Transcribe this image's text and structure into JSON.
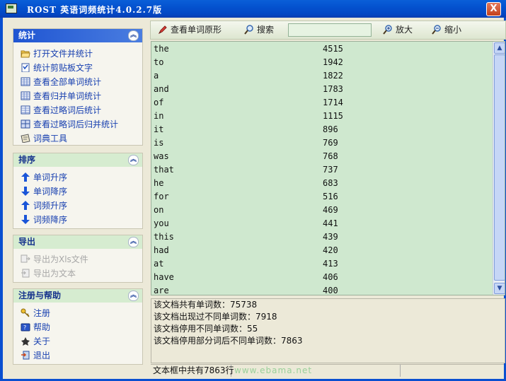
{
  "window": {
    "title": "ROST 英语词频统计4.0.2.7版",
    "close_label": "X"
  },
  "groups": [
    {
      "title": "统计",
      "items": [
        {
          "label": "打开文件并统计",
          "icon": "open-folder-icon"
        },
        {
          "label": "统计剪贴板文字",
          "icon": "clipboard-icon"
        },
        {
          "label": "查看全部单词统计",
          "icon": "table-icon"
        },
        {
          "label": "查看归并单词统计",
          "icon": "table-icon"
        },
        {
          "label": "查看过略词后统计",
          "icon": "table-icon"
        },
        {
          "label": "查看过略词后归并统计",
          "icon": "table-icon"
        },
        {
          "label": "词典工具",
          "icon": "dictionary-icon"
        }
      ]
    },
    {
      "title": "排序",
      "items": [
        {
          "label": "单词升序",
          "icon": "arrow-up-icon"
        },
        {
          "label": "单词降序",
          "icon": "arrow-down-icon"
        },
        {
          "label": "词频升序",
          "icon": "arrow-up-icon"
        },
        {
          "label": "词频降序",
          "icon": "arrow-down-icon"
        }
      ]
    },
    {
      "title": "导出",
      "items": [
        {
          "label": "导出为Xls文件",
          "icon": "export-xls-icon"
        },
        {
          "label": "导出为文本",
          "icon": "export-text-icon"
        }
      ]
    },
    {
      "title": "注册与帮助",
      "items": [
        {
          "label": "注册",
          "icon": "key-icon"
        },
        {
          "label": "帮助",
          "icon": "help-book-icon"
        },
        {
          "label": "关于",
          "icon": "about-icon"
        },
        {
          "label": "退出",
          "icon": "exit-door-icon"
        }
      ]
    }
  ],
  "toolbar": {
    "view_original": "查看单词原形",
    "search": "搜索",
    "search_value": "",
    "zoom_in": "放大",
    "zoom_out": "缩小"
  },
  "words": [
    {
      "w": "the",
      "c": "4515"
    },
    {
      "w": "to",
      "c": "1942"
    },
    {
      "w": "a",
      "c": "1822"
    },
    {
      "w": "and",
      "c": "1783"
    },
    {
      "w": "of",
      "c": "1714"
    },
    {
      "w": "in",
      "c": "1115"
    },
    {
      "w": "it",
      "c": "896"
    },
    {
      "w": "is",
      "c": "769"
    },
    {
      "w": "was",
      "c": "768"
    },
    {
      "w": "that",
      "c": "737"
    },
    {
      "w": "he",
      "c": "683"
    },
    {
      "w": "for",
      "c": "516"
    },
    {
      "w": "on",
      "c": "469"
    },
    {
      "w": "you",
      "c": "441"
    },
    {
      "w": "this",
      "c": "439"
    },
    {
      "w": "had",
      "c": "420"
    },
    {
      "w": "at",
      "c": "413"
    },
    {
      "w": "have",
      "c": "406"
    },
    {
      "w": "are",
      "c": "400"
    }
  ],
  "stats": [
    "该文档共有单词数：75738",
    "该文档出现过不同单词数：7918",
    "该文档停用不同单词数：55",
    "该文档停用部分词后不同单词数：7863"
  ],
  "status": {
    "lines": "文本框中共有7863行",
    "watermark": "www.ebama.net"
  },
  "colors": {
    "list_bg": "#cfe8cf",
    "title_bar": "#0452cf",
    "link_blue": "#1840b0"
  }
}
